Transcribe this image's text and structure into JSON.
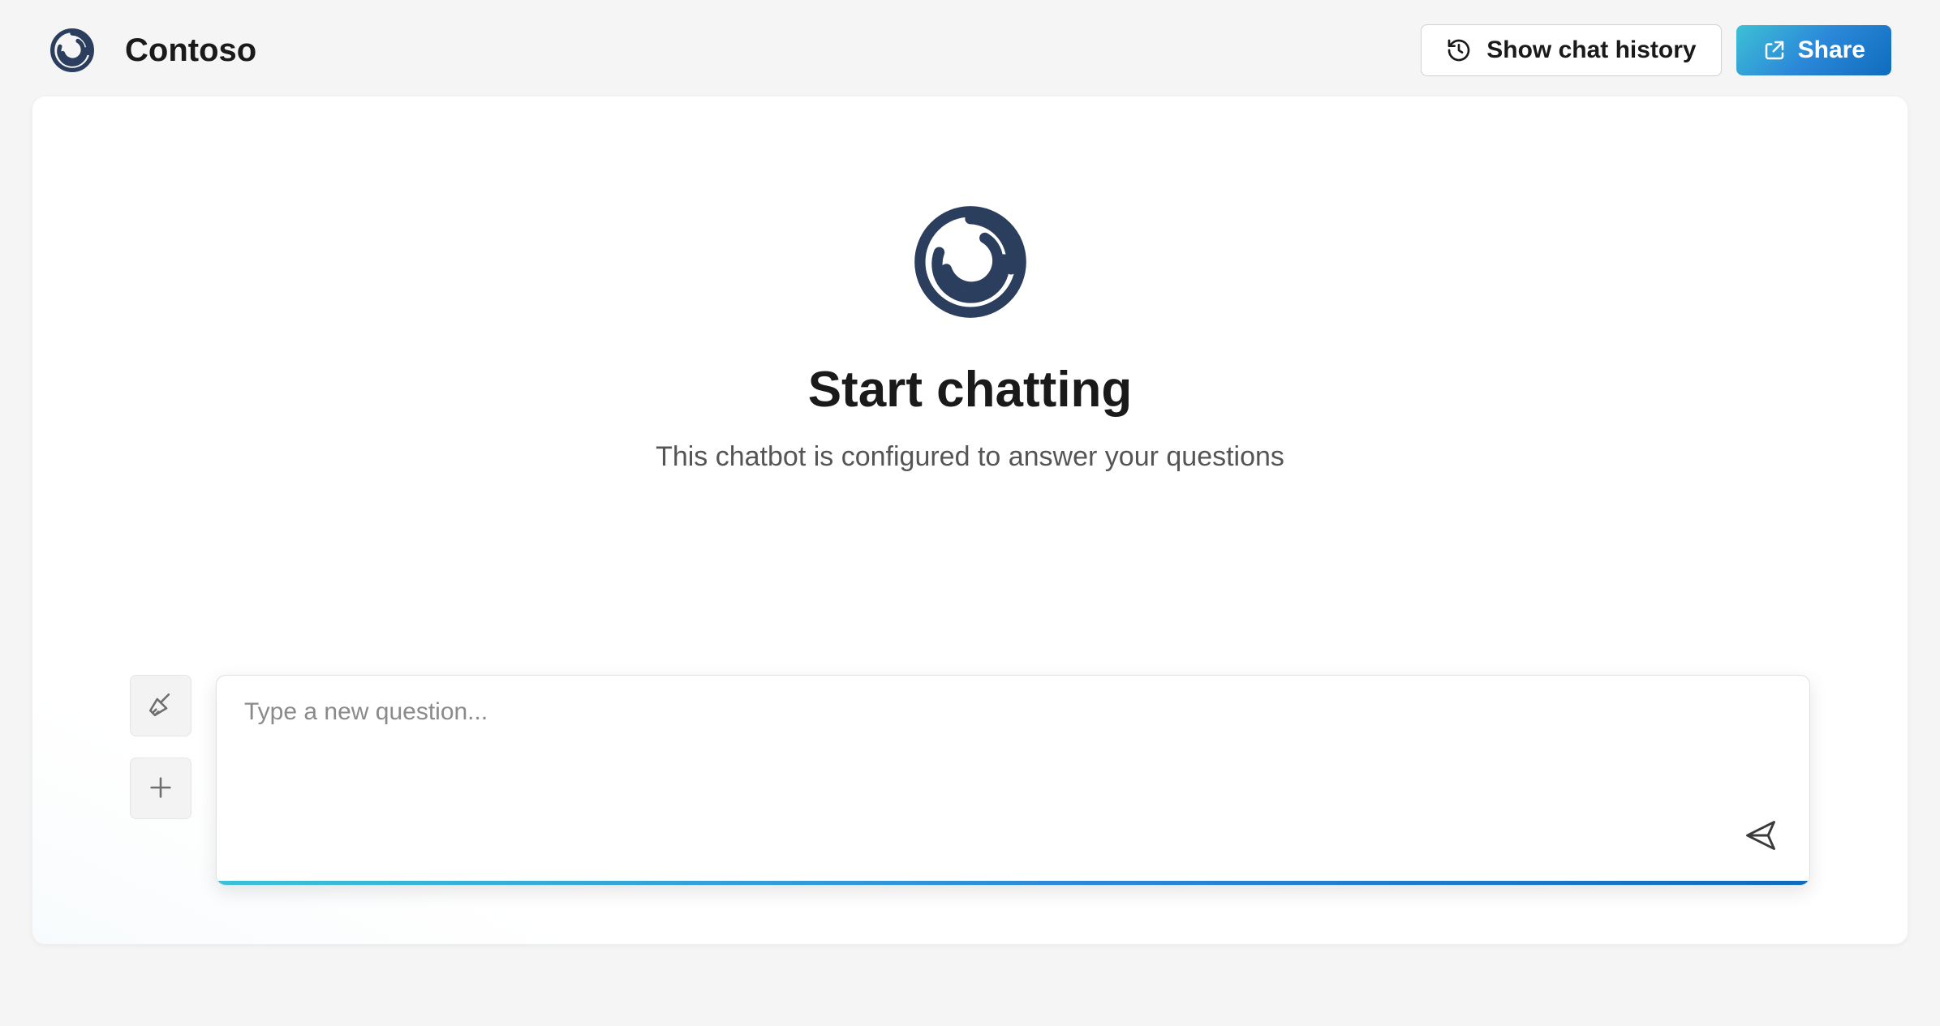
{
  "header": {
    "brand": "Contoso",
    "history_button_label": "Show chat history",
    "share_button_label": "Share"
  },
  "hero": {
    "title": "Start chatting",
    "subtitle": "This chatbot is configured to answer your questions"
  },
  "input": {
    "placeholder": "Type a new question..."
  },
  "colors": {
    "brand_navy": "#2c3e5e",
    "accent_gradient_start": "#3dc0d6",
    "accent_gradient_end": "#0f6cbd"
  }
}
